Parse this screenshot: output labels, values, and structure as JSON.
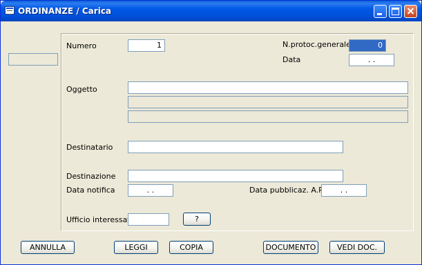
{
  "window": {
    "title": "ORDINANZE / Carica"
  },
  "form": {
    "numero_label": "Numero",
    "numero_value": "1",
    "nprotoc_label": "N.protoc.generale",
    "nprotoc_value": "0",
    "data_label": "Data",
    "data_value": ". .",
    "oggetto_label": "Oggetto",
    "oggetto_line1": "",
    "oggetto_line2": "",
    "oggetto_line3": "",
    "destinatario_label": "Destinatario",
    "destinatario_value": "",
    "destinazione_label": "Destinazione",
    "destinazione_value": "",
    "data_notifica_label": "Data notifica",
    "data_notifica_value": ". .",
    "data_pubblicaz_label": "Data pubblicaz. A.P.:",
    "data_pubblicaz_value": ". .",
    "ufficio_label": "Ufficio interessato",
    "ufficio_value": "",
    "ufficio_lookup_label": "?"
  },
  "buttons": {
    "annulla": "ANNULLA",
    "leggi": "LEGGI",
    "copia": "COPIA",
    "documento": "DOCUMENTO",
    "vedi_doc": "VEDI DOC."
  },
  "colors": {
    "titlebar": "#0058e6",
    "window_bg": "#ece9d8",
    "field_border": "#7f9db9",
    "selection": "#316ac5"
  },
  "icons": {
    "app": "form-window-icon",
    "minimize": "minimize-icon",
    "maximize": "maximize-icon",
    "close": "close-icon"
  }
}
